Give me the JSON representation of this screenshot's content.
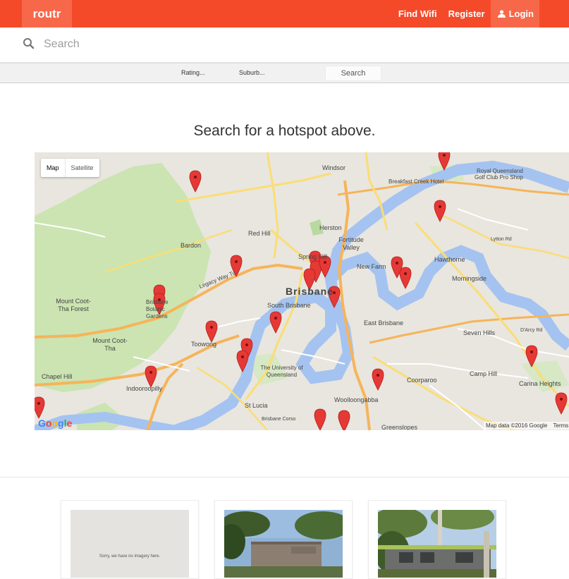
{
  "app": {
    "brand": "routr"
  },
  "nav": {
    "find_wifi": "Find Wifi",
    "register": "Register",
    "login": "Login",
    "login_icon": "user-icon"
  },
  "search": {
    "placeholder": "Search",
    "icon": "search-icon"
  },
  "filters": {
    "rating": "Rating...",
    "suburb": "Suburb...",
    "search_button": "Search"
  },
  "heading": "Search for a hotspot above.",
  "map": {
    "type_controls": [
      "Map",
      "Satellite"
    ],
    "attribution": "Map data ©2016 Google",
    "terms": "Terms",
    "google_logo": "Google",
    "labels": {
      "windsor": "Windsor",
      "breakfast_creek_hotel": "Breakfast Creek Hotel",
      "royal_queensland": "Royal Queensland",
      "golf_club": "Golf Club Pro Shop",
      "herston": "Herston",
      "red_hill": "Red Hill",
      "fortitude_valley": "Fortitude Valley",
      "bardon": "Bardon",
      "spring_hill": "Spring Hill",
      "new_farm": "New Farm",
      "hawthorne": "Hawthorne",
      "morningside": "Morningside",
      "brisbane": "Brisbane",
      "mount_coot_tha_forest": "Mount Coot-Tha Forest",
      "brisbane_botanic_gardens": "Brisbane Botanic Gardens",
      "south_brisbane": "South Brisbane",
      "east_brisbane": "East Brisbane",
      "seven_hills": "Seven Hills",
      "mount_coot_tha": "Mount Coot-Tha",
      "toowong": "Toowong",
      "chapel_hill": "Chapel Hill",
      "indooroopilly": "Indooroopilly",
      "uq": "The University of Queensland",
      "camp_hill": "Camp Hill",
      "coorparoo": "Coorparoo",
      "woolloongabba": "Woolloongabba",
      "carina_heights": "Carina Heights",
      "st_lucia": "St Lucia",
      "greenslopes": "Greenslopes",
      "legacy_way": "Legacy Way Tu",
      "brisbane_corso": "Brisbane Corso",
      "lytton_rd": "Lytton Rd",
      "darcy_rd": "D'Arcy Rd"
    },
    "marker_color": "#e53935",
    "marker_count": 27
  },
  "cards": [
    {
      "kind": "no-imagery",
      "text": "Sorry, we have no imagery here."
    },
    {
      "kind": "photo",
      "subject": "building"
    },
    {
      "kind": "photo",
      "subject": "house"
    }
  ],
  "colors": {
    "brand": "#f44a2a",
    "brand_light": "#f7684a",
    "water": "#a5c3f0",
    "park": "#cbe4b2",
    "motorway": "#f6b45a",
    "road": "#fbdd74"
  }
}
